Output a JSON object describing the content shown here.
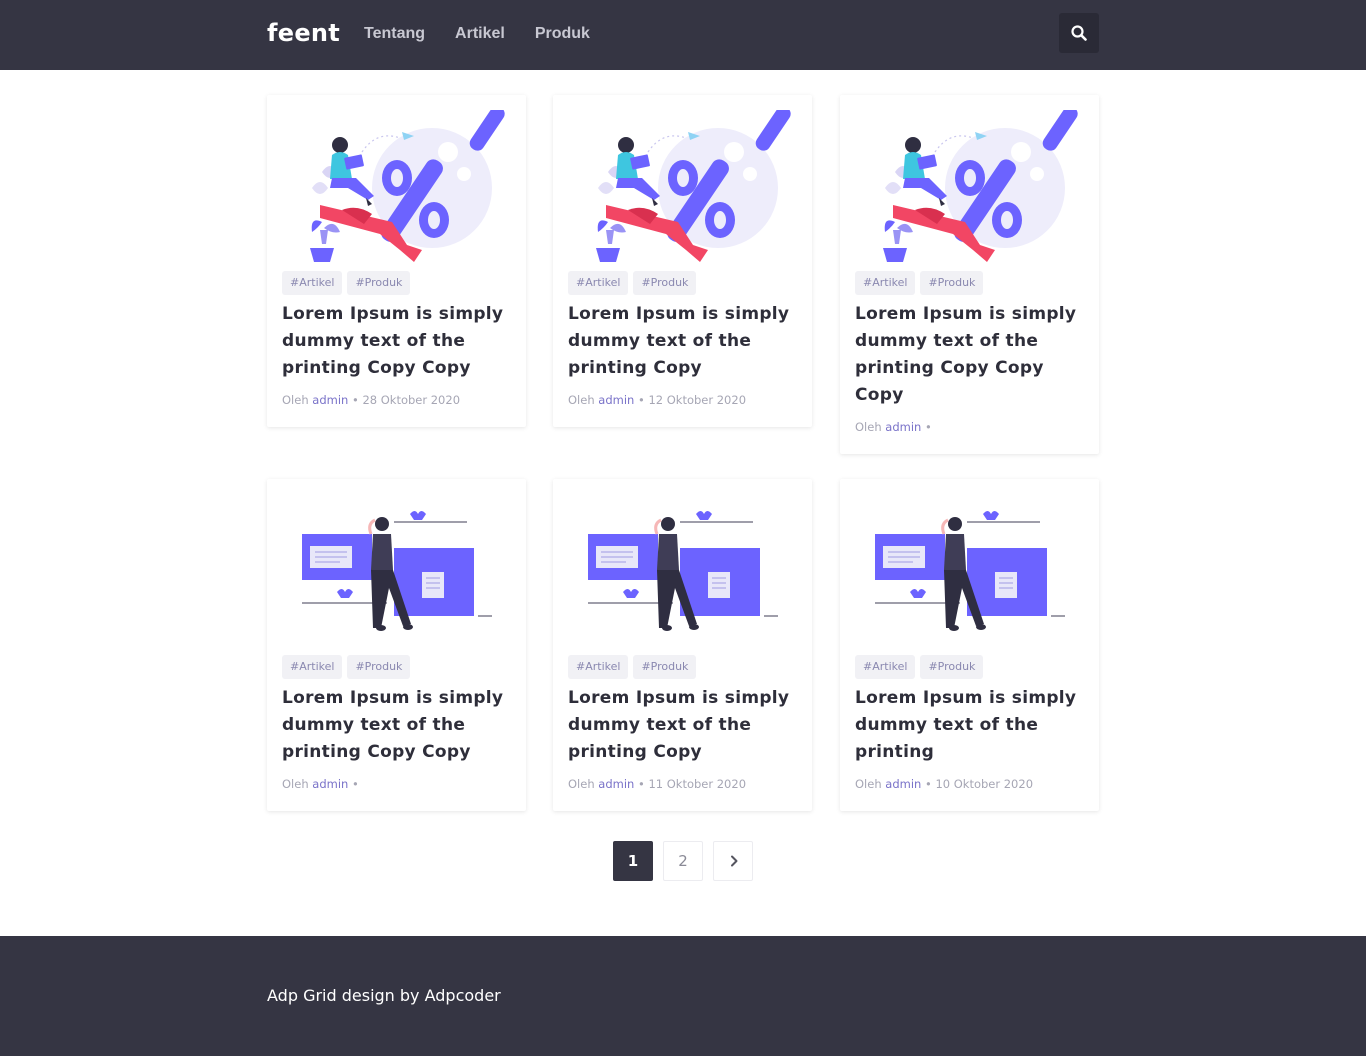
{
  "header": {
    "logo": "feent",
    "nav": [
      "Tentang",
      "Artikel",
      "Produk"
    ],
    "search_icon": "search-icon"
  },
  "posts": [
    {
      "illustration": "discount-percent",
      "tags": [
        "#Artikel",
        "#Produk"
      ],
      "title": "Lorem Ipsum is simply dummy text of the printing Copy Copy",
      "by": "Oleh",
      "author": "admin",
      "date": "28 Oktober 2020"
    },
    {
      "illustration": "discount-percent",
      "tags": [
        "#Artikel",
        "#Produk"
      ],
      "title": "Lorem Ipsum is simply dummy text of the printing Copy",
      "by": "Oleh",
      "author": "admin",
      "date": "12 Oktober 2020"
    },
    {
      "illustration": "discount-percent",
      "tags": [
        "#Artikel",
        "#Produk"
      ],
      "title": "Lorem Ipsum is simply dummy text of the printing Copy Copy Copy",
      "by": "Oleh",
      "author": "admin",
      "date": ""
    },
    {
      "illustration": "woman-documents",
      "tags": [
        "#Artikel",
        "#Produk"
      ],
      "title": "Lorem Ipsum is simply dummy text of the printing Copy Copy",
      "by": "Oleh",
      "author": "admin",
      "date": ""
    },
    {
      "illustration": "woman-documents",
      "tags": [
        "#Artikel",
        "#Produk"
      ],
      "title": "Lorem Ipsum is simply dummy text of the printing Copy",
      "by": "Oleh",
      "author": "admin",
      "date": "11 Oktober 2020"
    },
    {
      "illustration": "woman-documents",
      "tags": [
        "#Artikel",
        "#Produk"
      ],
      "title": "Lorem Ipsum is simply dummy text of the printing",
      "by": "Oleh",
      "author": "admin",
      "date": "10 Oktober 2020"
    }
  ],
  "pagination": {
    "pages": [
      "1",
      "2"
    ],
    "current": "1",
    "next_icon": "chevron-right-icon"
  },
  "footer": {
    "credit": "Adp Grid design by Adpcoder"
  },
  "colors": {
    "header_bg": "#353543",
    "accent": "#6c63ff",
    "red": "#f24664",
    "tag_text": "#8a88b0"
  }
}
